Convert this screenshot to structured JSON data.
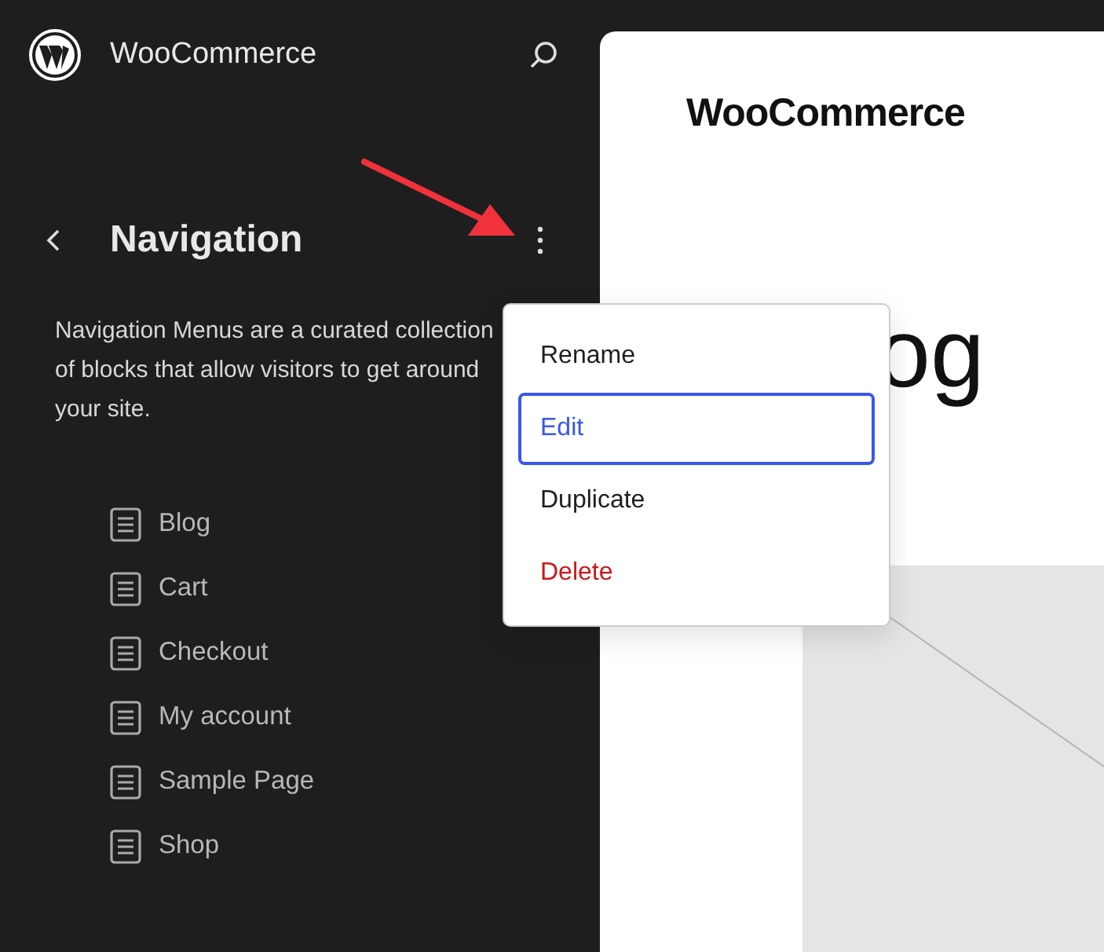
{
  "site": {
    "title": "WooCommerce"
  },
  "panel": {
    "title": "Navigation",
    "description": "Navigation Menus are a curated collection of blocks that allow visitors to get around your site."
  },
  "pages": [
    {
      "label": "Blog"
    },
    {
      "label": "Cart"
    },
    {
      "label": "Checkout"
    },
    {
      "label": "My account"
    },
    {
      "label": "Sample Page"
    },
    {
      "label": "Shop"
    }
  ],
  "menu": {
    "items": [
      {
        "label": "Rename",
        "kind": "normal",
        "selected": false
      },
      {
        "label": "Edit",
        "kind": "normal",
        "selected": true
      },
      {
        "label": "Duplicate",
        "kind": "normal",
        "selected": false
      },
      {
        "label": "Delete",
        "kind": "destructive",
        "selected": false
      }
    ]
  },
  "preview": {
    "site_title": "WooCommerce",
    "heading": "og"
  }
}
